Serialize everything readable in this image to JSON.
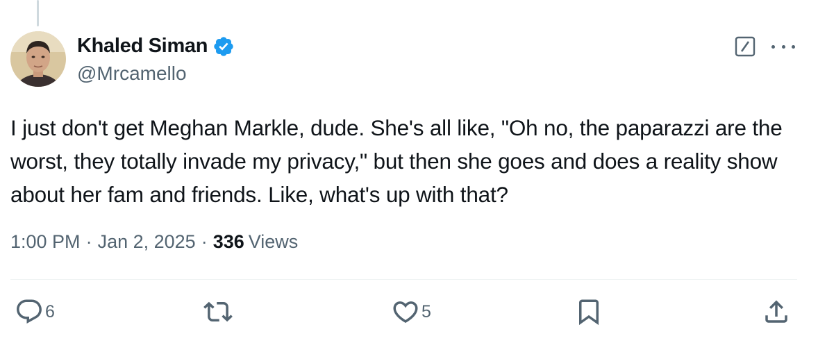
{
  "author": {
    "name": "Khaled Siman",
    "handle": "@Mrcamello",
    "verified": true
  },
  "tweet": {
    "text": "I just don't get Meghan Markle, dude. She's all like, \"Oh no, the paparazzi are the worst, they totally invade my privacy,\" but then she goes and does a reality show about her fam and friends. Like, what's up with that?",
    "time": "1:00 PM",
    "separator": "·",
    "date": "Jan 2, 2025",
    "views_count": "336",
    "views_label": "Views"
  },
  "actions": {
    "reply_count": "6",
    "like_count": "5"
  },
  "colors": {
    "verified": "#1d9bf0",
    "muted": "#536471",
    "text": "#0f1419"
  },
  "icons": [
    "verified-badge-icon",
    "grok-icon",
    "more-icon",
    "reply-icon",
    "retweet-icon",
    "like-icon",
    "bookmark-icon",
    "share-icon"
  ]
}
